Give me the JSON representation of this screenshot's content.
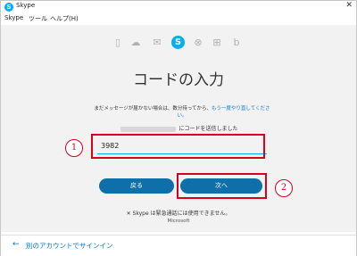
{
  "window": {
    "title": "Skype",
    "icon_letter": "S",
    "close_glyph": "✕"
  },
  "menu": {
    "items": [
      "Skype",
      "ツール",
      "ヘルプ(H)"
    ]
  },
  "service_icons": {
    "icons": [
      "office-icon",
      "onedrive-icon",
      "outlook-icon",
      "skype-icon",
      "xbox-icon",
      "windows-icon",
      "bing-icon"
    ],
    "glyphs": [
      "▯",
      "☁",
      "✉",
      "S",
      "⊗",
      "⊞",
      "b"
    ]
  },
  "page": {
    "heading": "コードの入力",
    "info_text_1": "まだメッセージが届かない場合は、数分待ってから、",
    "info_link": "もう一度やり直してください。",
    "sent_suffix": "にコードを送信しました"
  },
  "code_field": {
    "value": "3982"
  },
  "annotations": {
    "step1": "1",
    "step2": "2"
  },
  "buttons": {
    "back_label": "戻る",
    "next_label": "次へ"
  },
  "notices": {
    "emergency": "Skype は緊急通話には使用できません。",
    "emergency_icon": "✕",
    "microsoft": "Microsoft"
  },
  "footer": {
    "arrow_glyph": "←",
    "signin_other": "別のアカウントでサインイン"
  },
  "colors": {
    "accent": "#00aff0",
    "button": "#0e6fa9",
    "highlight_red": "#d8001d",
    "link": "#0078d7"
  }
}
